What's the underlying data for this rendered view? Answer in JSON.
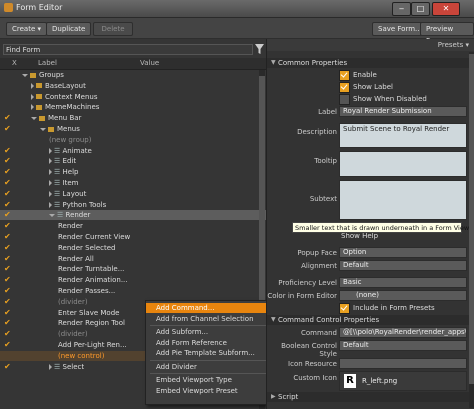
{
  "window": {
    "title": "Form Editor",
    "btn_min": "‒",
    "btn_max": "□",
    "btn_close": "✕"
  },
  "toolbar": {
    "create": "Create ▾",
    "duplicate": "Duplicate",
    "delete": "Delete",
    "save_form": "Save Form...",
    "preview_form": "Preview Form"
  },
  "left": {
    "search_placeholder": "Find Form",
    "columns": [
      "",
      "X",
      "Label",
      "Value"
    ],
    "rows": [
      {
        "indent": 0,
        "type": "folder",
        "label": "Groups",
        "chk": false,
        "expanded": true
      },
      {
        "indent": 1,
        "type": "folder",
        "label": "BaseLayout",
        "chk": false
      },
      {
        "indent": 1,
        "type": "folder",
        "label": "Context Menus",
        "chk": false
      },
      {
        "indent": 1,
        "type": "folder",
        "label": "MemeMachines",
        "chk": false
      },
      {
        "indent": 1,
        "type": "folder",
        "label": "Menu Bar",
        "chk": true,
        "expanded": true
      },
      {
        "indent": 2,
        "type": "folder",
        "label": "Menus",
        "chk": true,
        "expanded": true
      },
      {
        "indent": 3,
        "type": "dim",
        "label": "(new group)",
        "chk": false
      },
      {
        "indent": 3,
        "type": "item",
        "label": "Animate",
        "chk": true
      },
      {
        "indent": 3,
        "type": "item",
        "label": "Edit",
        "chk": true
      },
      {
        "indent": 3,
        "type": "item",
        "label": "Help",
        "chk": true
      },
      {
        "indent": 3,
        "type": "item",
        "label": "Item",
        "chk": true
      },
      {
        "indent": 3,
        "type": "item",
        "label": "Layout",
        "chk": true
      },
      {
        "indent": 3,
        "type": "item",
        "label": "Python Tools",
        "chk": true
      },
      {
        "indent": 3,
        "type": "item",
        "label": "Render",
        "chk": true,
        "selected": true,
        "expanded": true
      },
      {
        "indent": 4,
        "type": "leaf",
        "label": "Render",
        "chk": true
      },
      {
        "indent": 4,
        "type": "leaf",
        "label": "Render Current View",
        "chk": true
      },
      {
        "indent": 4,
        "type": "leaf",
        "label": "Render Selected",
        "chk": true
      },
      {
        "indent": 4,
        "type": "leaf",
        "label": "Render All",
        "chk": true
      },
      {
        "indent": 4,
        "type": "leaf",
        "label": "Render Turntable...",
        "chk": true
      },
      {
        "indent": 4,
        "type": "leaf",
        "label": "Render Animation...",
        "chk": true
      },
      {
        "indent": 4,
        "type": "leaf",
        "label": "Render Passes...",
        "chk": true
      },
      {
        "indent": 4,
        "type": "div",
        "label": "(divider)",
        "chk": true
      },
      {
        "indent": 4,
        "type": "leaf",
        "label": "Enter Slave Mode",
        "chk": true
      },
      {
        "indent": 4,
        "type": "leaf",
        "label": "Render Region Tool",
        "chk": true
      },
      {
        "indent": 4,
        "type": "div",
        "label": "(divider)",
        "chk": true
      },
      {
        "indent": 4,
        "type": "leaf",
        "label": "Add Per-Light Ren...",
        "chk": true
      },
      {
        "indent": 4,
        "type": "new",
        "label": "(new control)",
        "chk": false
      },
      {
        "indent": 3,
        "type": "item",
        "label": "Select",
        "chk": true
      }
    ]
  },
  "context_menu": [
    {
      "label": "Add Command...",
      "active": true
    },
    {
      "label": "Add from Channel Selection"
    },
    {
      "sep": true
    },
    {
      "label": "Add Subform..."
    },
    {
      "label": "Add Form Reference"
    },
    {
      "label": "Add Pie Template Subform..."
    },
    {
      "sep": true
    },
    {
      "label": "Add Divider"
    },
    {
      "sep": true
    },
    {
      "label": "Embed Viewport Type"
    },
    {
      "label": "Embed Viewport Preset"
    }
  ],
  "right": {
    "presets": "Presets ▾",
    "common_header": "Common Properties",
    "enable": "Enable",
    "show_label": "Show Label",
    "show_when_disabled": "Show When Disabled",
    "label_lbl": "Label",
    "label_val": "Royal Render Submission",
    "desc_lbl": "Description",
    "desc_val": "Submit Scene to Royal Render",
    "tooltip_lbl": "Tooltip",
    "subtext_lbl": "Subtext",
    "tooltip_popup": "Smaller text that is drawn underneath in a Form View",
    "show_help": "Show Help",
    "popup_face_lbl": "Popup Face",
    "popup_face_val": "Option",
    "alignment_lbl": "Alignment",
    "alignment_val": "Default",
    "proficiency_lbl": "Proficiency Level",
    "proficiency_val": "Basic",
    "color_lbl": "Color in Form Editor",
    "color_val": "(none)",
    "include_presets": "Include in Form Presets",
    "cmd_header": "Command Control Properties",
    "command_lbl": "Command",
    "command_val": "@[\\\\polo\\RoyalRender\\render_apps\\_subm",
    "bool_lbl": "Boolean Control Style",
    "bool_val": "Default",
    "icon_res_lbl": "Icon Resource",
    "custom_icon_lbl": "Custom Icon",
    "custom_icon_val": "R_left.png",
    "script_header": "Script"
  }
}
